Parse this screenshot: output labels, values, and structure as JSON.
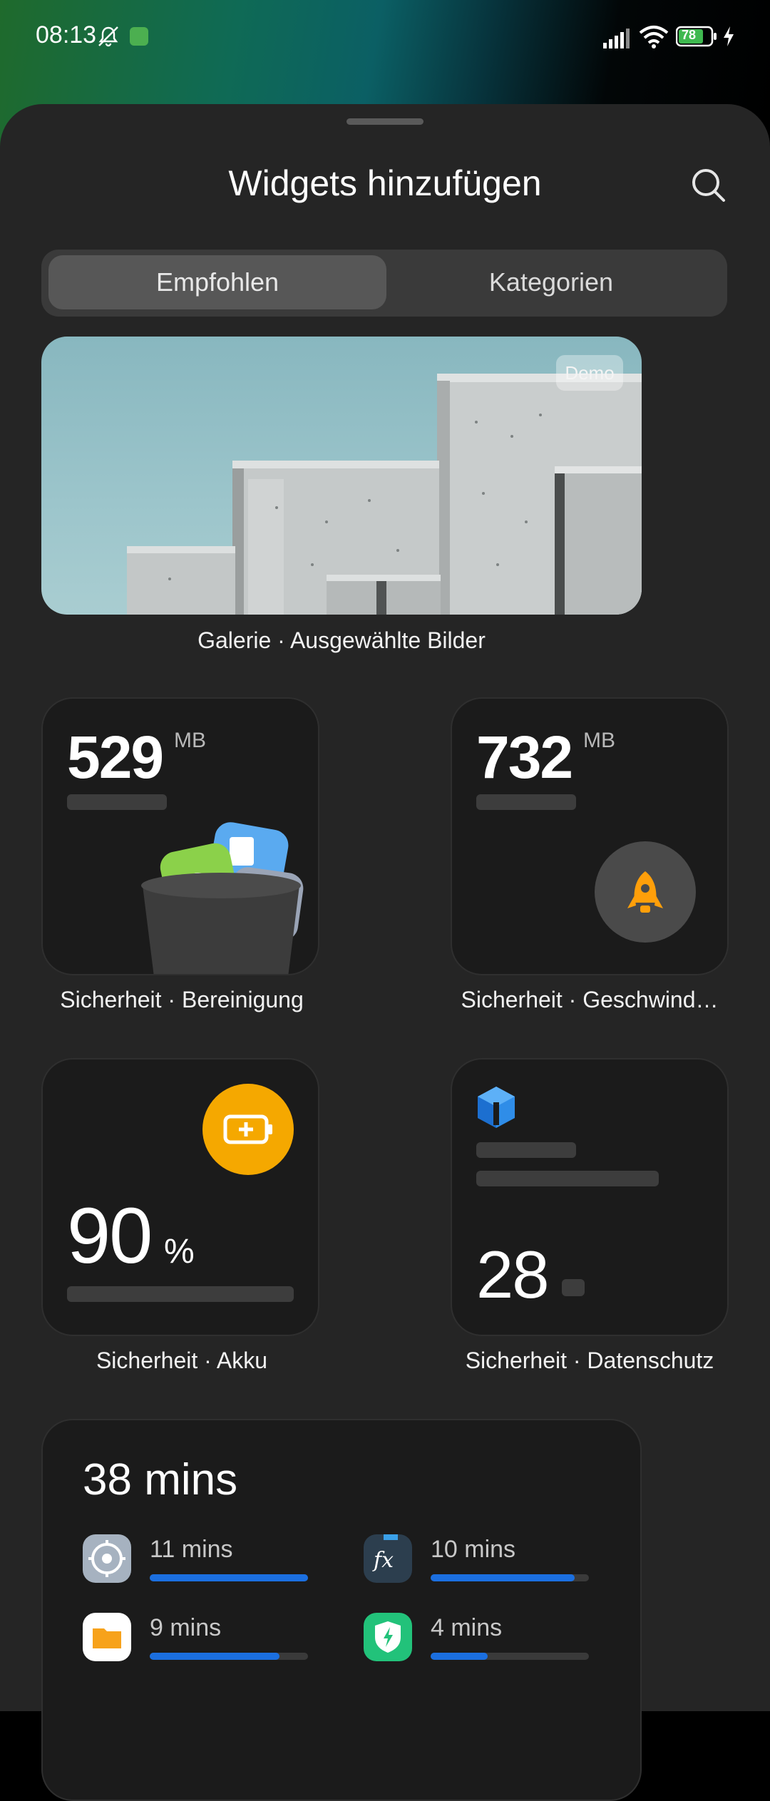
{
  "status_bar": {
    "time": "08:13",
    "battery": "78",
    "icons": [
      "bell-off-icon",
      "app-badge-icon",
      "signal-icon",
      "wifi-icon",
      "battery-icon",
      "charging-icon"
    ]
  },
  "sheet": {
    "title": "Widgets hinzufügen",
    "tabs": [
      {
        "label": "Empfohlen",
        "active": true
      },
      {
        "label": "Kategorien",
        "active": false
      }
    ]
  },
  "widgets": {
    "gallery": {
      "badge": "Demo",
      "caption": "Galerie · Ausgewählte Bilder"
    },
    "cleaner": {
      "value": "529",
      "unit": "MB",
      "caption": "Sicherheit · Bereinigung"
    },
    "booster": {
      "value": "732",
      "unit": "MB",
      "caption": "Sicherheit · Geschwind…"
    },
    "battery": {
      "value": "90",
      "unit": "%",
      "caption": "Sicherheit · Akku"
    },
    "privacy": {
      "value": "28",
      "caption": "Sicherheit · Datenschutz"
    },
    "screen_time": {
      "total": "38 mins",
      "apps": [
        {
          "icon": "settings-icon",
          "value": "11 mins",
          "level": 1.0
        },
        {
          "icon": "formula-icon",
          "value": "10 mins",
          "level": 0.91
        },
        {
          "icon": "folder-icon",
          "value": "9 mins",
          "level": 0.82
        },
        {
          "icon": "security-shield-icon",
          "value": "4 mins",
          "level": 0.36
        }
      ]
    }
  },
  "colors": {
    "sheet_bg": "#252525",
    "card_bg": "#1b1b1b",
    "accent_blue": "#1b6fe0",
    "battery_orange": "#f5a800",
    "rocket_orange": "#ff9f0a"
  }
}
